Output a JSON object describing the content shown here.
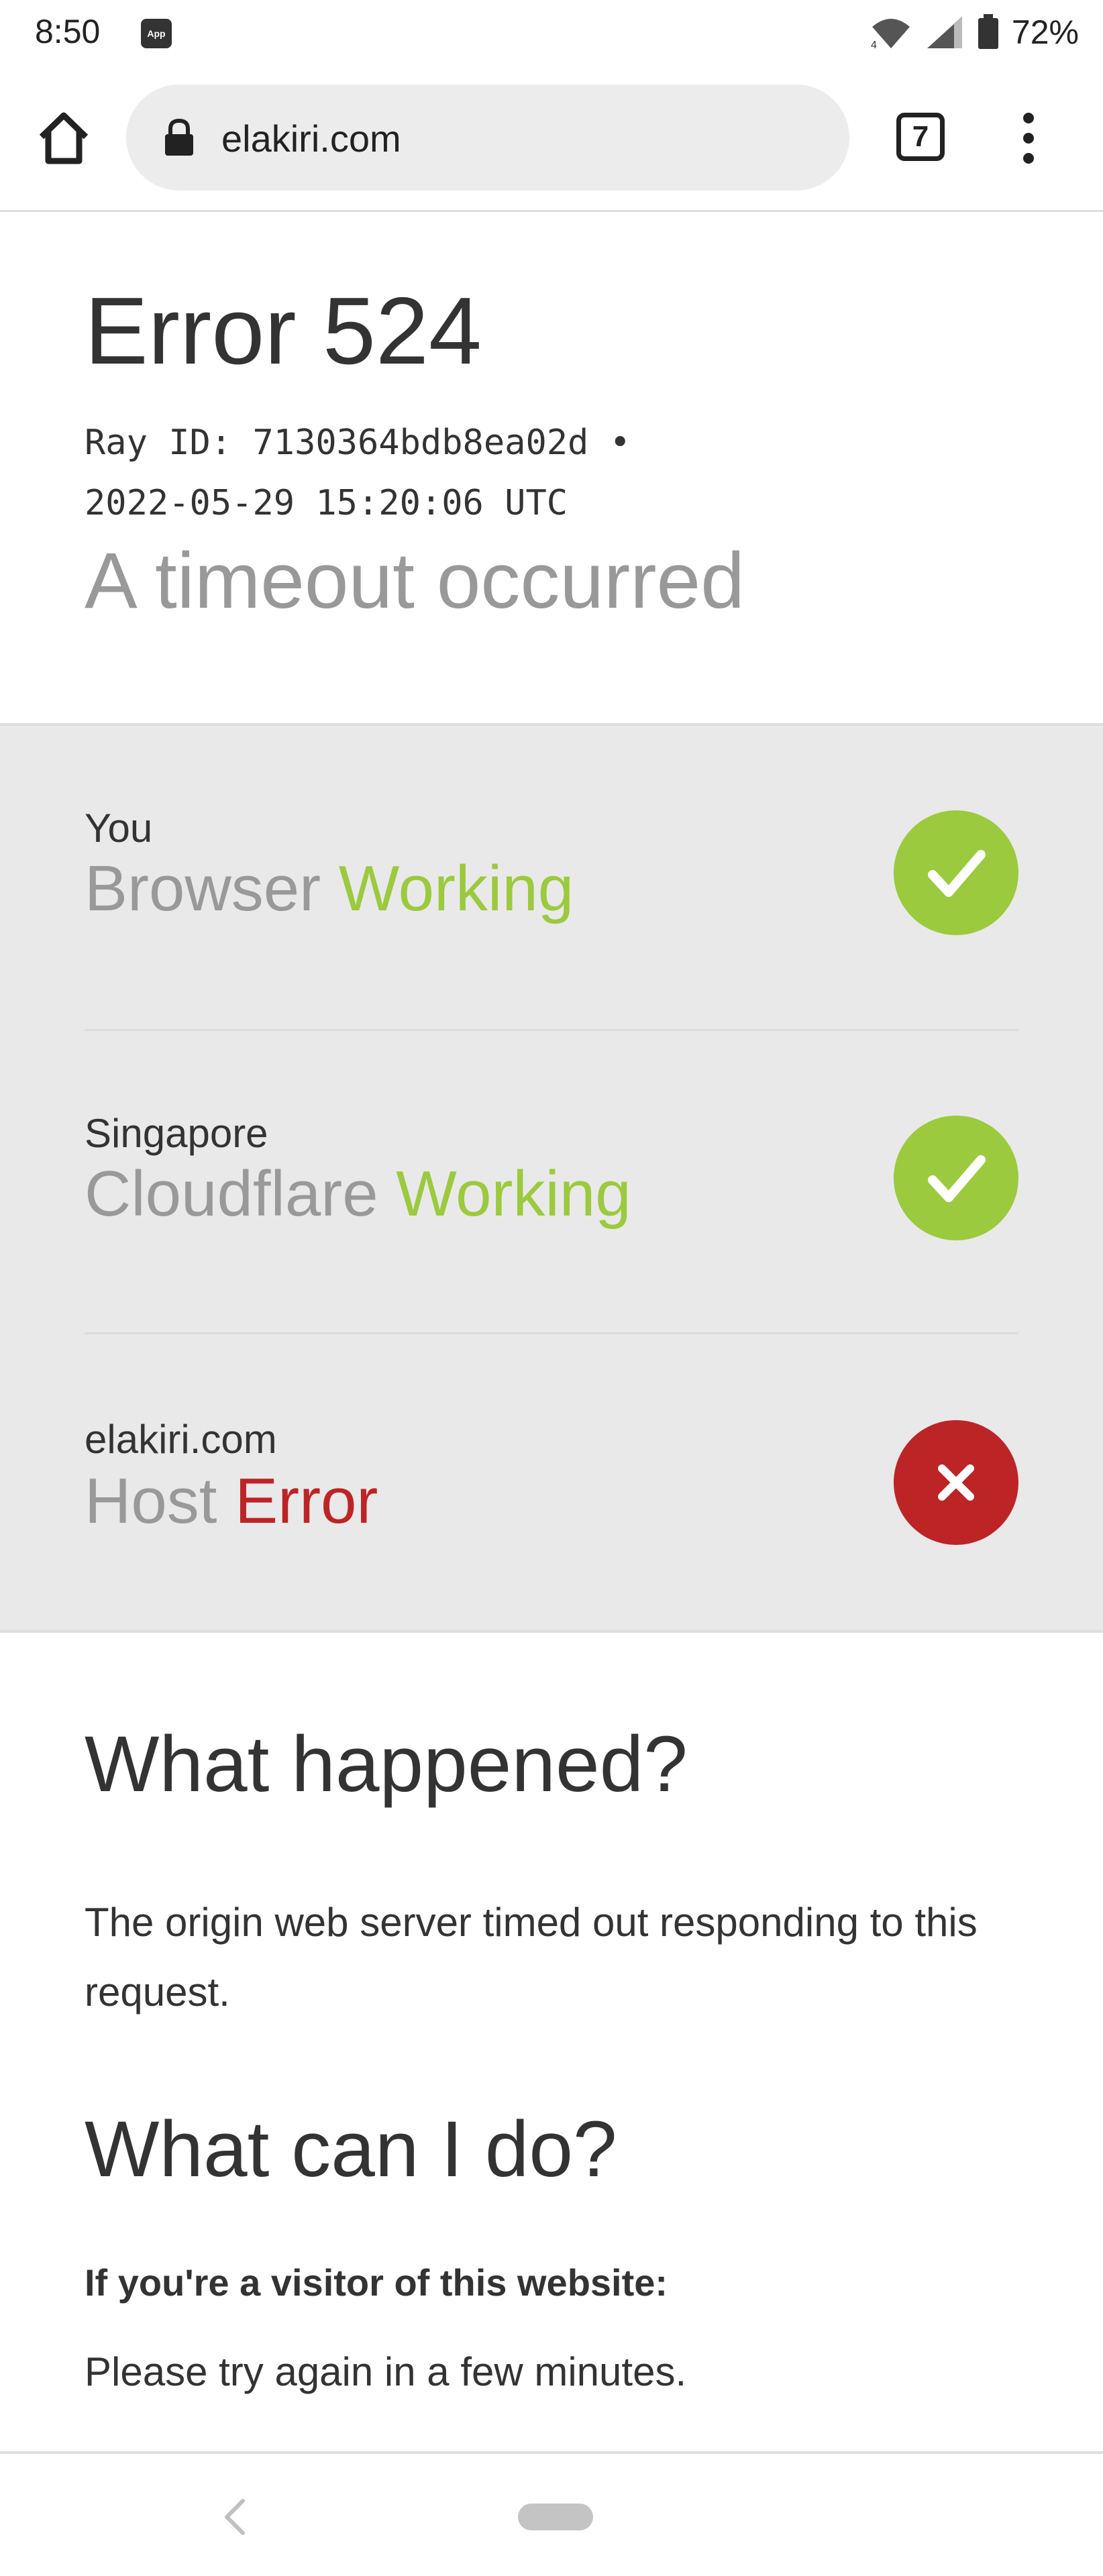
{
  "status_bar": {
    "time": "8:50",
    "app_notification_label": "App",
    "battery_percent": "72%"
  },
  "browser": {
    "url": "elakiri.com",
    "tab_count": "7"
  },
  "error": {
    "title": "Error 524",
    "ray_id_line": "Ray ID: 7130364bdb8ea02d •",
    "timestamp_line": "2022-05-29 15:20:06 UTC",
    "subtitle": "A timeout occurred"
  },
  "status_rows": [
    {
      "location": "You",
      "name": "Browser",
      "state": "Working",
      "status": "ok"
    },
    {
      "location": "Singapore",
      "name": "Cloudflare",
      "state": "Working",
      "status": "ok"
    },
    {
      "location": "elakiri.com",
      "name": "Host",
      "state": "Error",
      "status": "error"
    }
  ],
  "sections": {
    "what_happened": {
      "heading": "What happened?",
      "text": "The origin web server timed out responding to this request."
    },
    "what_can_i_do": {
      "heading": "What can I do?",
      "visitor_label": "If you're a visitor of this website:",
      "visitor_text": "Please try again in a few minutes."
    }
  },
  "colors": {
    "ok": "#9bca3e",
    "error": "#bd2426",
    "panel_bg": "#e9e9e9",
    "muted_text": "#999999"
  },
  "icons": {
    "home": "home-icon",
    "lock": "lock-icon",
    "menu": "more-vertical-icon",
    "ok": "checkmark-icon",
    "error": "x-icon",
    "back": "chevron-left-icon"
  }
}
